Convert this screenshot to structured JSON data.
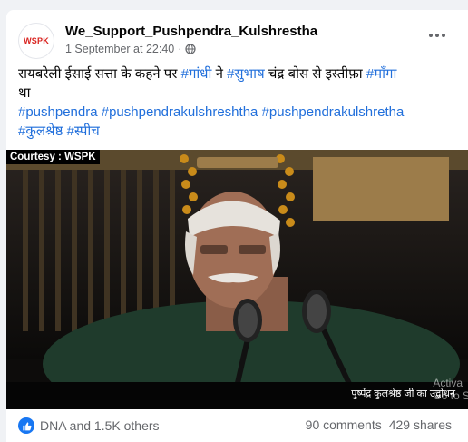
{
  "post": {
    "page_name": "We_Support_Pushpendra_Kulshrestha",
    "timestamp": "1 September at 22:40",
    "separator": "·",
    "avatar_text": "WSPK",
    "text": {
      "line1": {
        "t1": "रायबरेली  ईसाई सत्ता के कहने पर ",
        "tag1": "#गांधी",
        "t2": " ने ",
        "tag2": "#सुभाष",
        "t3": "  चंद्र बोस से इस्तीफ़ा ",
        "tag3": "#माँगा"
      },
      "line2": "था",
      "line3": {
        "tag1": "#pushpendra",
        "tag2": "#pushpendrakulshreshtha",
        "tag3": "#pushpendrakulshretha"
      },
      "line4": {
        "tag1": "#कुलश्रेष्ठ",
        "tag2": "#स्पीच"
      }
    }
  },
  "video": {
    "courtesy": "Courtesy : WSPK",
    "caption": "पुष्पेंद्र कुलश्रेष्ठ जी का उद्बोधन",
    "watermark_line1": "Activa",
    "watermark_line2": "Go to S"
  },
  "footer": {
    "reactions": "DNA and 1.5K others",
    "comments": "90 comments",
    "shares": "429 shares"
  },
  "icons": {
    "globe": "globe-icon",
    "more": "more-options-icon",
    "like": "like-icon"
  },
  "colors": {
    "hashtag": "#216fdb",
    "like": "#1877f2",
    "brand": "#d9231f"
  }
}
